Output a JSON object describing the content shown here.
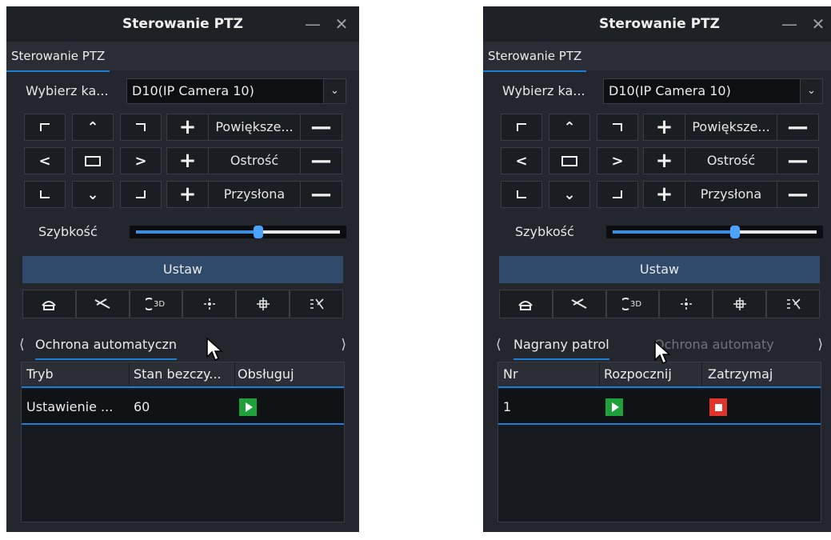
{
  "window": {
    "title": "Sterowanie PTZ",
    "minimize_glyph": "—",
    "close_glyph": "✕"
  },
  "tab_label": "Sterowanie PTZ",
  "camera_select": {
    "label": "Wybierz ka...",
    "value": "D10(IP Camera 10)"
  },
  "lens": {
    "zoom_label": "Powiększe...",
    "focus_label": "Ostrość",
    "iris_label": "Przysłona"
  },
  "speed": {
    "label": "Szybkość",
    "level_fraction": 0.6
  },
  "set_button_label": "Ustaw",
  "function_icons": [
    "wiper-icon",
    "light-icon",
    "3d-positioning-icon",
    "auto-focus-icon",
    "lens-init-icon",
    "menu-icon"
  ],
  "left_panel": {
    "subtab_active": "Ochrona automatyczn",
    "table": {
      "headers": [
        "Tryb",
        "Stan bezczy...",
        "Obsługuj"
      ],
      "row": {
        "mode": "Ustawienie ...",
        "idle": "60"
      }
    }
  },
  "right_panel": {
    "subtab_active": "Nagrany patrol",
    "subtab_inactive": "Ochrona automaty",
    "table": {
      "headers": [
        "Nr",
        "Rozpocznij",
        "Zatrzymaj"
      ],
      "row": {
        "no": "1"
      }
    }
  },
  "colors": {
    "accent": "#1b7fd6",
    "play": "#1ea03a",
    "stop": "#e0342a",
    "set_button": "#2f4a6a"
  }
}
